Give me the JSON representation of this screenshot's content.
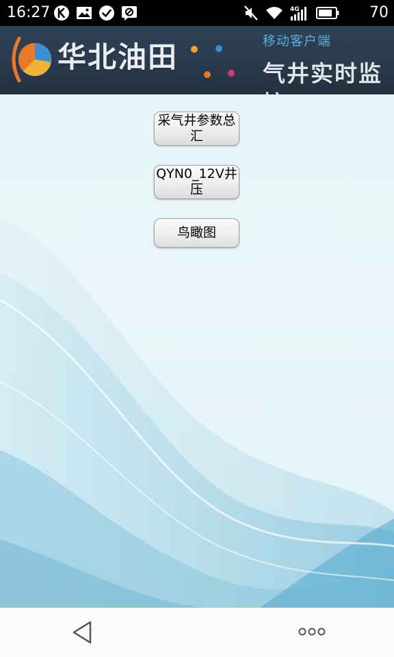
{
  "status_bar": {
    "time": "16:27",
    "battery_level": "70",
    "left_icons": [
      "k-app-icon",
      "image-icon",
      "check-circle-icon",
      "blocked-icon"
    ],
    "right_icons": [
      "mute-icon",
      "wifi-icon",
      "signal-4g-icon",
      "battery-icon"
    ],
    "network_label": "4G"
  },
  "header": {
    "company_name": "华北油田",
    "subtitle_small": "移动客户端",
    "subtitle_big": "气井实时监控",
    "logo_colors": [
      "#e8792a",
      "#f2b233",
      "#3a8fd6"
    ]
  },
  "main": {
    "buttons": [
      {
        "label": "采气井参数总汇"
      },
      {
        "label": "QYN0_12V井压"
      },
      {
        "label": "鸟瞰图"
      }
    ]
  },
  "nav_bar": {
    "back": "back-icon",
    "more": "more-dots-icon"
  },
  "colors": {
    "header_bg": "#2a3b4d",
    "content_bg": "#e7f5f8",
    "wave": "#7fc0da"
  }
}
